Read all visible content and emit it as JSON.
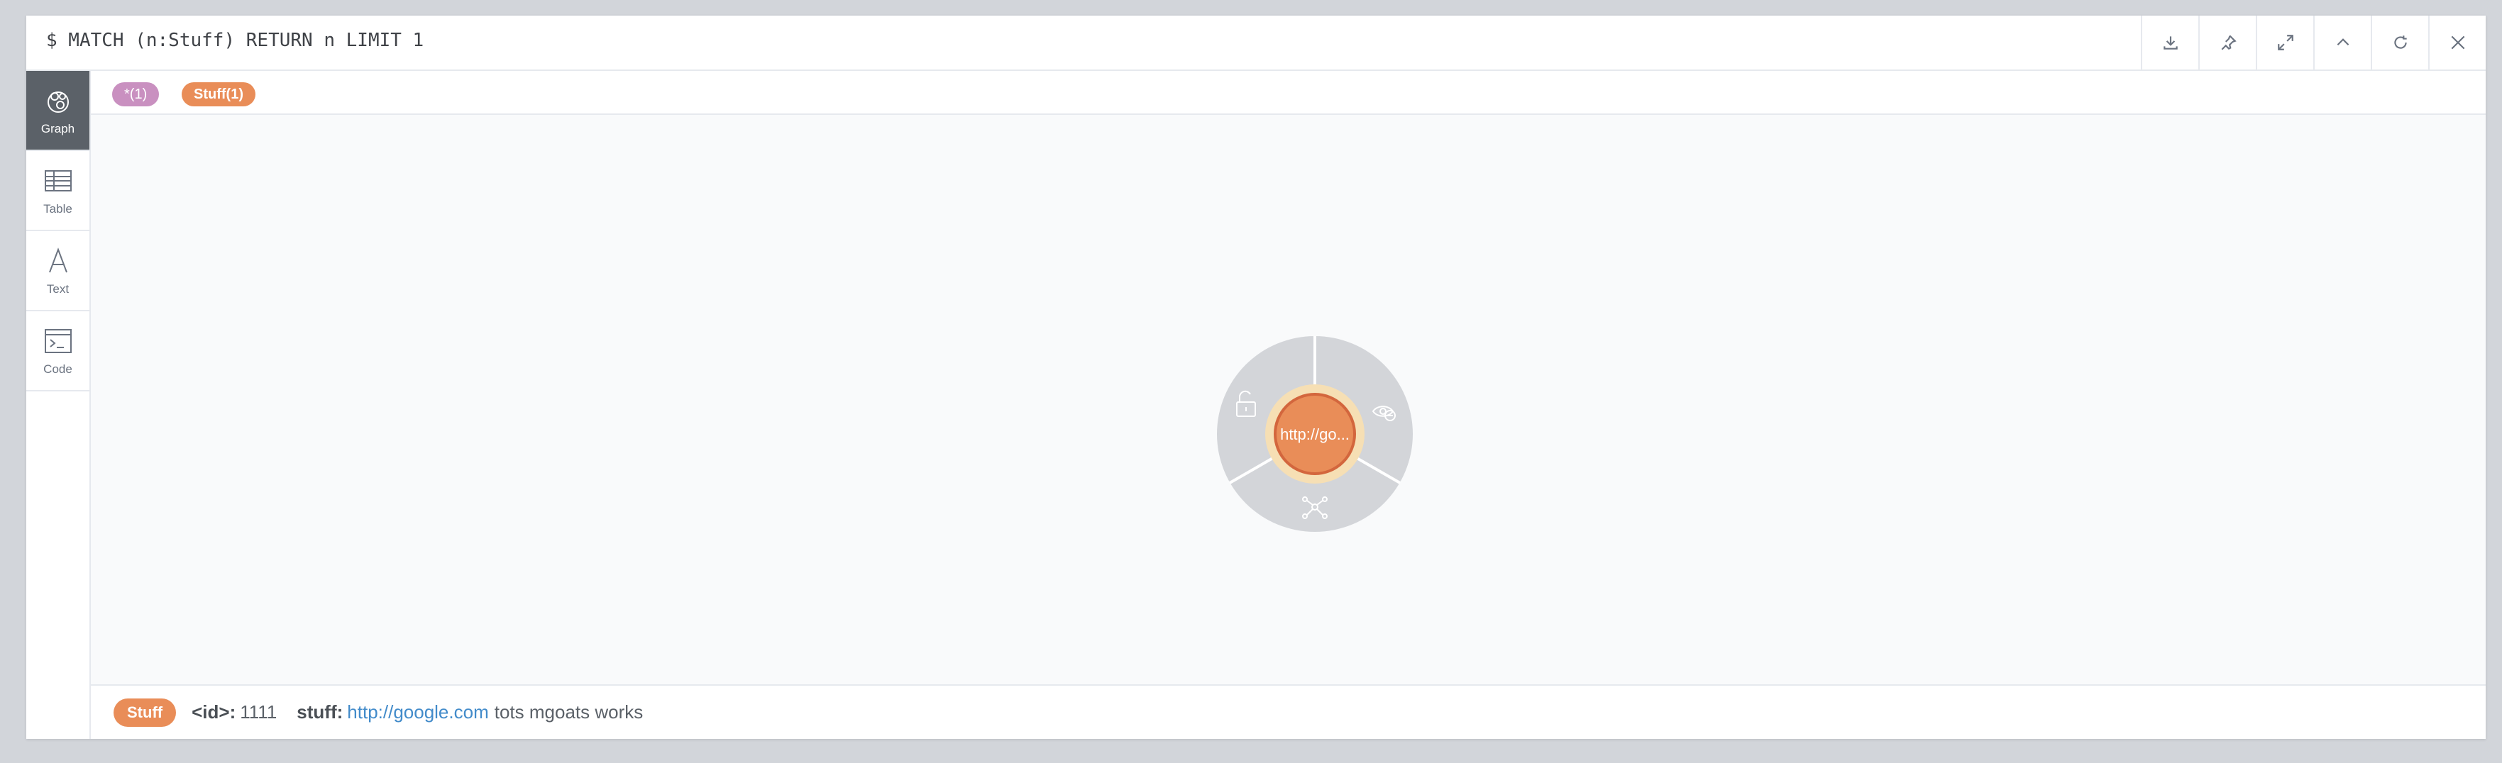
{
  "header": {
    "query": "$ MATCH (n:Stuff) RETURN n LIMIT 1",
    "buttons": [
      {
        "icon": "download-icon"
      },
      {
        "icon": "pin-icon"
      },
      {
        "icon": "expand-icon"
      },
      {
        "icon": "collapse-up-icon"
      },
      {
        "icon": "rerun-icon"
      },
      {
        "icon": "close-icon"
      }
    ]
  },
  "sidebar": {
    "items": [
      {
        "label": "Graph",
        "icon": "graph-icon",
        "active": true
      },
      {
        "label": "Table",
        "icon": "table-icon"
      },
      {
        "label": "Text",
        "icon": "text-icon"
      },
      {
        "label": "Code",
        "icon": "code-icon"
      }
    ]
  },
  "labels": {
    "all": "*(1)",
    "stuff": "Stuff(1)"
  },
  "node": {
    "caption": "http://go...",
    "menu": [
      "unlock-icon",
      "hide-icon",
      "expand-neighbors-icon"
    ]
  },
  "footer": {
    "label": "Stuff",
    "id_key": "<id>:",
    "id_value": "1111",
    "prop_key": "stuff:",
    "prop_link": "http://google.com",
    "prop_rest": "tots mgoats works"
  },
  "colors": {
    "node_fill": "#e98d58",
    "node_border": "#d3663d",
    "all_pill": "#c990c0",
    "active_tab": "#5b6168",
    "ring": "#d3d5d9",
    "halo": "#f6dfb4"
  }
}
